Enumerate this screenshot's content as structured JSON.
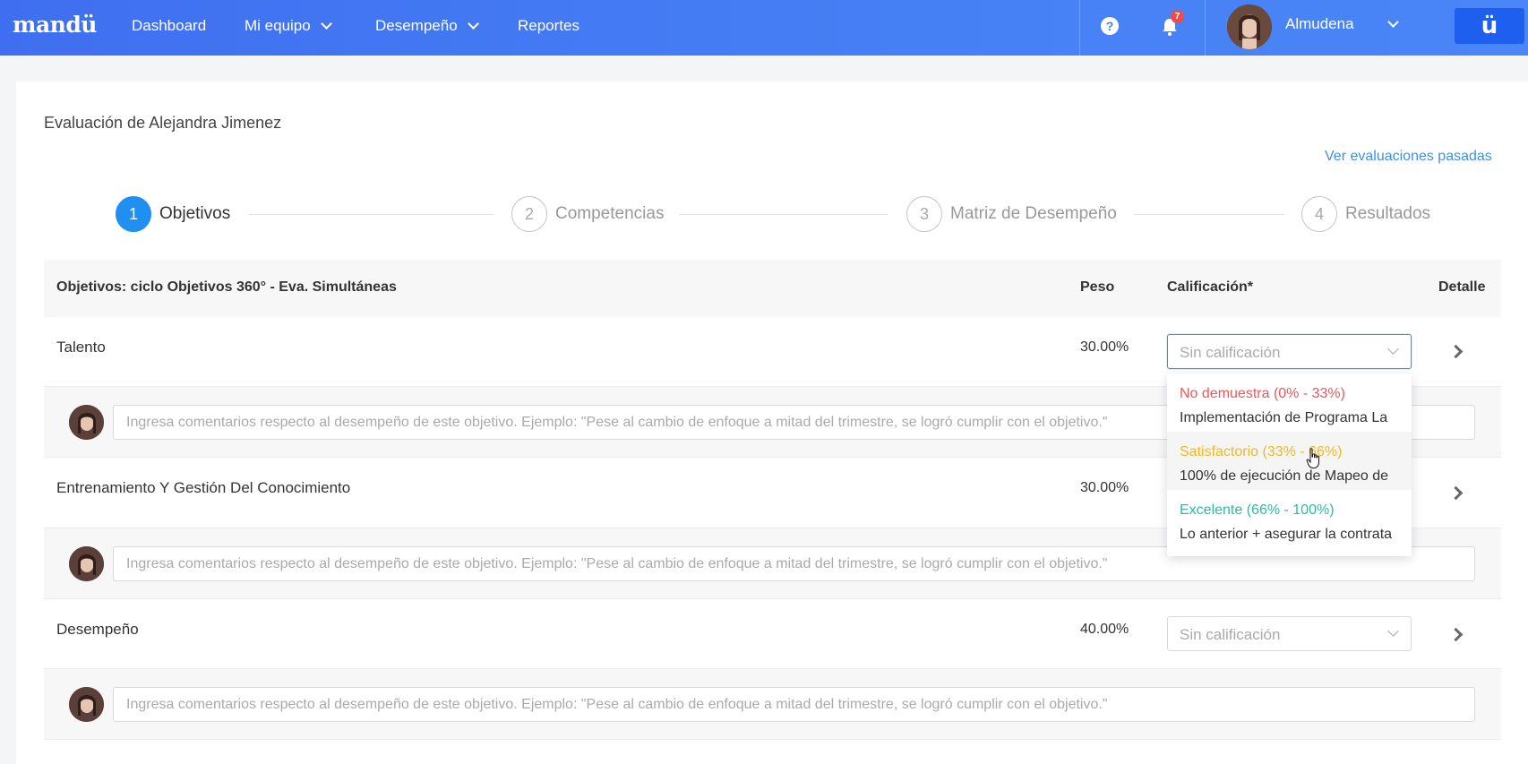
{
  "nav": {
    "logo": "mandü",
    "items": [
      "Dashboard",
      "Mi equipo",
      "Desempeño",
      "Reportes"
    ],
    "help_icon": "?",
    "notification_count": "7",
    "user_name": "Almudena",
    "brand_button": "ü"
  },
  "page": {
    "title": "Evaluación de Alejandra Jimenez",
    "past_link": "Ver evaluaciones pasadas"
  },
  "steps": [
    {
      "num": "1",
      "label": "Objetivos",
      "active": true
    },
    {
      "num": "2",
      "label": "Competencias",
      "active": false
    },
    {
      "num": "3",
      "label": "Matriz de Desempeño",
      "active": false
    },
    {
      "num": "4",
      "label": "Resultados",
      "active": false
    }
  ],
  "table": {
    "col_objetivos": "Objetivos: ciclo Objetivos 360° - Eva. Simultáneas",
    "col_peso": "Peso",
    "col_calificacion": "Calificación*",
    "col_detalle": "Detalle",
    "rows": [
      {
        "name": "Talento",
        "weight": "30.00%",
        "rating_placeholder": "Sin calificación",
        "rating_placeholder_visible": true
      },
      {
        "name": "Entrenamiento Y Gestión Del Conocimiento",
        "weight": "30.00%",
        "rating_placeholder": "Sin calificación",
        "rating_placeholder_visible": false
      },
      {
        "name": "Desempeño",
        "weight": "40.00%",
        "rating_placeholder": "Sin calificación",
        "rating_placeholder_visible": true
      }
    ],
    "comment_placeholder": "Ingresa comentarios respecto al desempeño de este objetivo. Ejemplo: \"Pese al cambio de enfoque a mitad del trimestre, se logró cumplir con el objetivo.\""
  },
  "dropdown": {
    "options": [
      {
        "title": "No demuestra (0% - 33%)",
        "desc": "Implementación de Programa La",
        "color": "#e8595a"
      },
      {
        "title": "Satisfactorio (33% - 66%)",
        "desc": "100% de ejecución de Mapeo de",
        "color": "#f2b824"
      },
      {
        "title": "Excelente (66% - 100%)",
        "desc": "Lo anterior + asegurar la contrata",
        "color": "#26bfa2"
      }
    ]
  },
  "colors": {
    "primary": "#1f8ff2",
    "nav_gradient_start": "#3f6ff0",
    "nav_gradient_end": "#4a86f7",
    "link": "#3d8ff0"
  }
}
